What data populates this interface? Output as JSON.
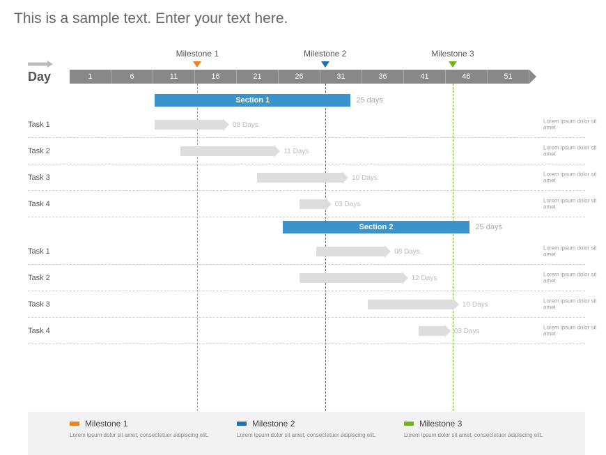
{
  "title": "This is a sample text. Enter your text here.",
  "day_label": "Day",
  "scale": {
    "ticks": [
      "1",
      "6",
      "11",
      "16",
      "21",
      "26",
      "31",
      "36",
      "41",
      "46",
      "51"
    ]
  },
  "milestones": [
    {
      "label": "Milestone 1",
      "day": 16,
      "color": "#e8851f"
    },
    {
      "label": "Milestone 2",
      "day": 31,
      "color": "#1f6fb8"
    },
    {
      "label": "Milestone 3",
      "day": 46,
      "color": "#6fb61f"
    }
  ],
  "sections": [
    {
      "label": "Section 1",
      "start": 11,
      "end": 34,
      "days_label": "25 days",
      "tasks": [
        {
          "name": "Task 1",
          "start": 11,
          "end": 19,
          "days_label": "08 Days",
          "note": "Lorem ipsum dolor sit amet"
        },
        {
          "name": "Task 2",
          "start": 14,
          "end": 25,
          "days_label": "11 Days",
          "note": "Lorem ipsum dolor sit amet"
        },
        {
          "name": "Task 3",
          "start": 23,
          "end": 33,
          "days_label": "10 Days",
          "note": "Lorem ipsum dolor sit amet"
        },
        {
          "name": "Task 4",
          "start": 28,
          "end": 31,
          "days_label": "03 Days",
          "note": "Lorem ipsum dolor sit amet"
        }
      ]
    },
    {
      "label": "Section 2",
      "start": 26,
      "end": 48,
      "days_label": "25 days",
      "tasks": [
        {
          "name": "Task 1",
          "start": 30,
          "end": 38,
          "days_label": "08 Days",
          "note": "Lorem ipsum dolor sit amet"
        },
        {
          "name": "Task 2",
          "start": 28,
          "end": 40,
          "days_label": "12 Days",
          "note": "Lorem ipsum dolor sit amet"
        },
        {
          "name": "Task 3",
          "start": 36,
          "end": 46,
          "days_label": "10 Days",
          "note": "Lorem ipsum dolor sit amet"
        },
        {
          "name": "Task 4",
          "start": 42,
          "end": 45,
          "days_label": "03 Days",
          "note": "Lorem ipsum dolor sit amet"
        }
      ]
    }
  ],
  "legend": [
    {
      "label": "Milestone 1",
      "color": "#e8851f",
      "desc": "Lorem ipsum dolor sit amet, consectetuer adipiscing elit."
    },
    {
      "label": "Milestone 2",
      "color": "#1f6fb8",
      "desc": "Lorem ipsum dolor sit amet, consectetuer adipiscing elit."
    },
    {
      "label": "Milestone 3",
      "color": "#6fb61f",
      "desc": "Lorem ipsum dolor sit amet, consectetuer adipiscing elit."
    }
  ],
  "chart_data": {
    "type": "gantt",
    "title": "Timeline with milestones",
    "x_unit": "Day",
    "x_range": [
      1,
      55
    ],
    "x_ticks": [
      1,
      6,
      11,
      16,
      21,
      26,
      31,
      36,
      41,
      46,
      51
    ],
    "milestones": [
      {
        "name": "Milestone 1",
        "x": 16,
        "color": "#e8851f"
      },
      {
        "name": "Milestone 2",
        "x": 31,
        "color": "#1f6fb8"
      },
      {
        "name": "Milestone 3",
        "x": 46,
        "color": "#6fb61f"
      }
    ],
    "groups": [
      {
        "name": "Section 1",
        "start": 11,
        "end": 34,
        "duration_days": 25,
        "bars": [
          {
            "name": "Task 1",
            "start": 11,
            "end": 19,
            "duration_days": 8
          },
          {
            "name": "Task 2",
            "start": 14,
            "end": 25,
            "duration_days": 11
          },
          {
            "name": "Task 3",
            "start": 23,
            "end": 33,
            "duration_days": 10
          },
          {
            "name": "Task 4",
            "start": 28,
            "end": 31,
            "duration_days": 3
          }
        ]
      },
      {
        "name": "Section 2",
        "start": 26,
        "end": 48,
        "duration_days": 25,
        "bars": [
          {
            "name": "Task 1",
            "start": 30,
            "end": 38,
            "duration_days": 8
          },
          {
            "name": "Task 2",
            "start": 28,
            "end": 40,
            "duration_days": 12
          },
          {
            "name": "Task 3",
            "start": 36,
            "end": 46,
            "duration_days": 10
          },
          {
            "name": "Task 4",
            "start": 42,
            "end": 45,
            "duration_days": 3
          }
        ]
      }
    ]
  }
}
